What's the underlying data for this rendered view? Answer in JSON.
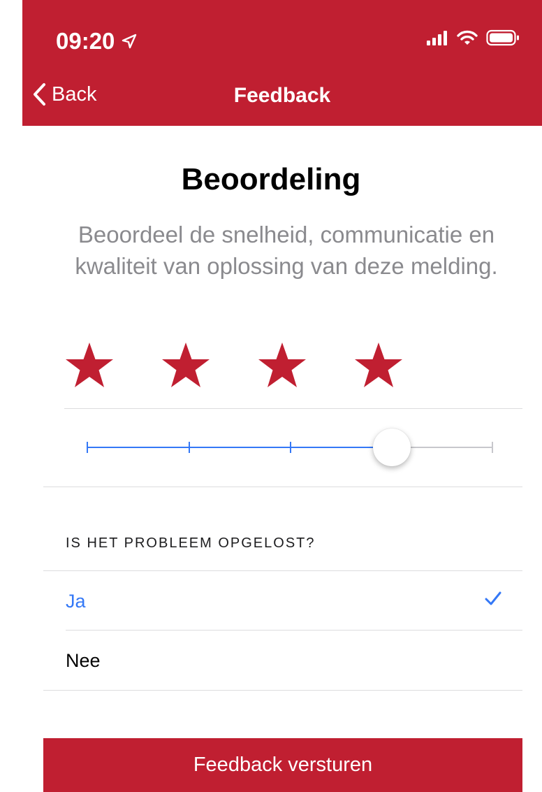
{
  "colors": {
    "brand": "#c01f31",
    "accent_blue": "#3478f6",
    "track_gray": "#c7c7cc",
    "subtitle_gray": "#8a8a8e"
  },
  "status_bar": {
    "time": "09:20",
    "icons": [
      "location-arrow-icon",
      "signal-icon",
      "wifi-icon",
      "battery-icon"
    ]
  },
  "nav": {
    "back_label": "Back",
    "title": "Feedback"
  },
  "main": {
    "title": "Beoordeling",
    "subtitle": "Beoordeel de snelheid, communicatie en kwaliteit van oplossing van deze melding.",
    "rating": {
      "value": 4,
      "max": 5,
      "slider_fraction": 0.75
    }
  },
  "question": {
    "header": "IS HET PROBLEEM OPGELOST?",
    "options": [
      {
        "label": "Ja",
        "selected": true
      },
      {
        "label": "Nee",
        "selected": false
      }
    ]
  },
  "submit": {
    "label": "Feedback versturen"
  }
}
